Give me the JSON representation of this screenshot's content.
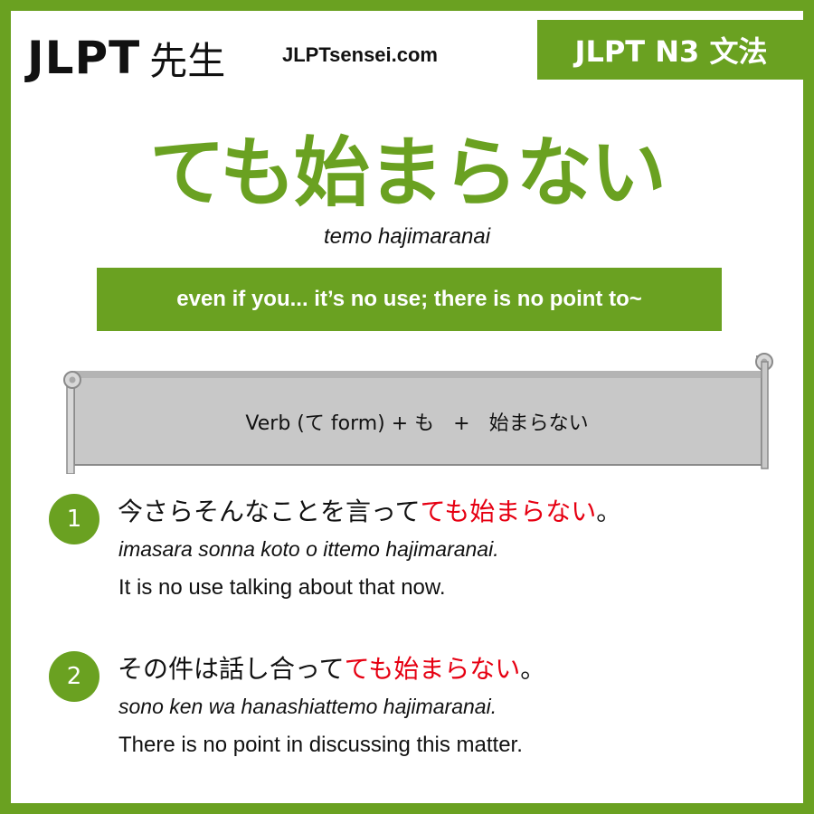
{
  "header": {
    "logo_latin": "JLPT",
    "logo_kanji": "先生",
    "site_url": "JLPTsensei.com",
    "level_badge": "JLPT N3 文法"
  },
  "grammar": {
    "title": "ても始まらない",
    "romaji": "temo hajimaranai",
    "meaning": "even if you... it’s no use; there is no point to~",
    "formula": "Verb (て form) + も   +   始まらない"
  },
  "colors": {
    "accent": "#6aa121",
    "highlight": "#e60012",
    "scroll_fill": "#c8c8c8"
  },
  "examples": [
    {
      "number": "1",
      "japanese_prefix": "今さらそんなことを言って",
      "japanese_highlight": "ても始まらない",
      "japanese_suffix": "。",
      "romaji": "imasara sonna koto o ittemo hajimaranai.",
      "english": "It is no use talking about that now."
    },
    {
      "number": "2",
      "japanese_prefix": "その件は話し合って",
      "japanese_highlight": "ても始まらない",
      "japanese_suffix": "。",
      "romaji": "sono ken wa hanashiattemo hajimaranai.",
      "english": "There is no point in discussing this matter."
    }
  ]
}
